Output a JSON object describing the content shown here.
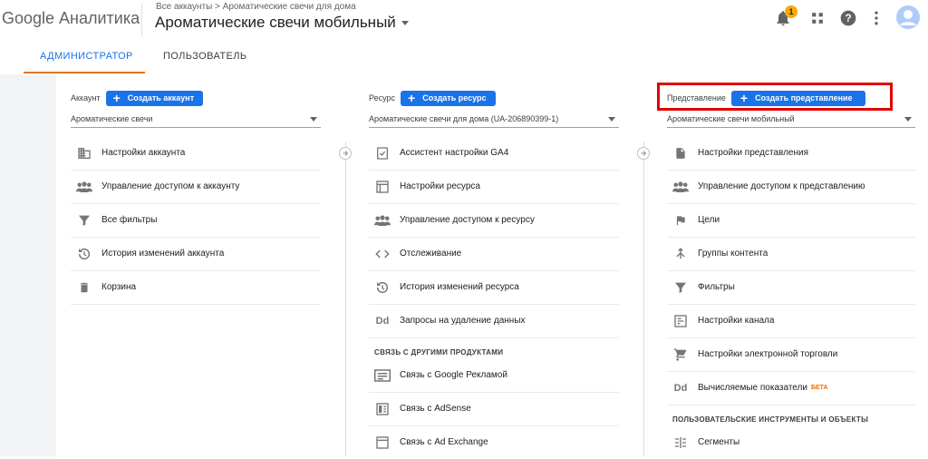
{
  "header": {
    "logo": "Google Аналитика",
    "breadcrumb": "Все аккаунты > Ароматические свечи для дома",
    "property_title": "Ароматические свечи мобильный",
    "notifications_count": "1"
  },
  "tabs": [
    {
      "label": "АДМИНИСТРАТОР"
    },
    {
      "label": "ПОЛЬЗОВАТЕЛЬ"
    }
  ],
  "account": {
    "label": "Аккаунт",
    "create_button": "Создать аккаунт",
    "selected": "Ароматические свечи",
    "items": [
      {
        "label": "Настройки аккаунта",
        "icon": "building-icon"
      },
      {
        "label": "Управление доступом к аккаунту",
        "icon": "people-icon"
      },
      {
        "label": "Все фильтры",
        "icon": "filter-icon"
      },
      {
        "label": "История изменений аккаунта",
        "icon": "history-icon"
      },
      {
        "label": "Корзина",
        "icon": "trash-icon"
      }
    ]
  },
  "property": {
    "label": "Ресурс",
    "create_button": "Создать ресурс",
    "selected": "Ароматические свечи для дома (UA-206890399-1)",
    "items": [
      {
        "label": "Ассистент настройки GA4",
        "icon": "checklist-icon"
      },
      {
        "label": "Настройки ресурса",
        "icon": "window-icon"
      },
      {
        "label": "Управление доступом к ресурсу",
        "icon": "people-icon"
      },
      {
        "label": "Отслеживание",
        "icon": "code-icon"
      },
      {
        "label": "История изменений ресурса",
        "icon": "history-icon"
      },
      {
        "label": "Запросы на удаление данных",
        "icon": "dd-icon"
      }
    ],
    "section_title": "СВЯЗЬ С ДРУГИМИ ПРОДУКТАМИ",
    "links": [
      {
        "label": "Связь с Google Рекламой",
        "icon": "ads-icon"
      },
      {
        "label": "Связь с AdSense",
        "icon": "adsense-icon"
      },
      {
        "label": "Связь с Ad Exchange",
        "icon": "adexchange-icon"
      }
    ]
  },
  "view": {
    "label": "Представление",
    "create_button": "Создать представление",
    "selected": "Ароматические свечи мобильный",
    "items": [
      {
        "label": "Настройки представления",
        "icon": "document-icon"
      },
      {
        "label": "Управление доступом к представлению",
        "icon": "people-icon"
      },
      {
        "label": "Цели",
        "icon": "flag-icon"
      },
      {
        "label": "Группы контента",
        "icon": "content-groups-icon"
      },
      {
        "label": "Фильтры",
        "icon": "filter-icon"
      },
      {
        "label": "Настройки канала",
        "icon": "channel-icon"
      },
      {
        "label": "Настройки электронной торговли",
        "icon": "cart-icon"
      },
      {
        "label": "Вычисляемые показатели",
        "icon": "dd-icon",
        "badge": "БЕТА"
      }
    ],
    "section_title": "ПОЛЬЗОВАТЕЛЬСКИЕ ИНСТРУМЕНТЫ И ОБЪЕКТЫ",
    "tools": [
      {
        "label": "Сегменты",
        "icon": "segments-icon"
      }
    ]
  },
  "colors": {
    "accent": "#1a73e8",
    "tab_underline": "#e37400",
    "highlight": "#e00000"
  }
}
